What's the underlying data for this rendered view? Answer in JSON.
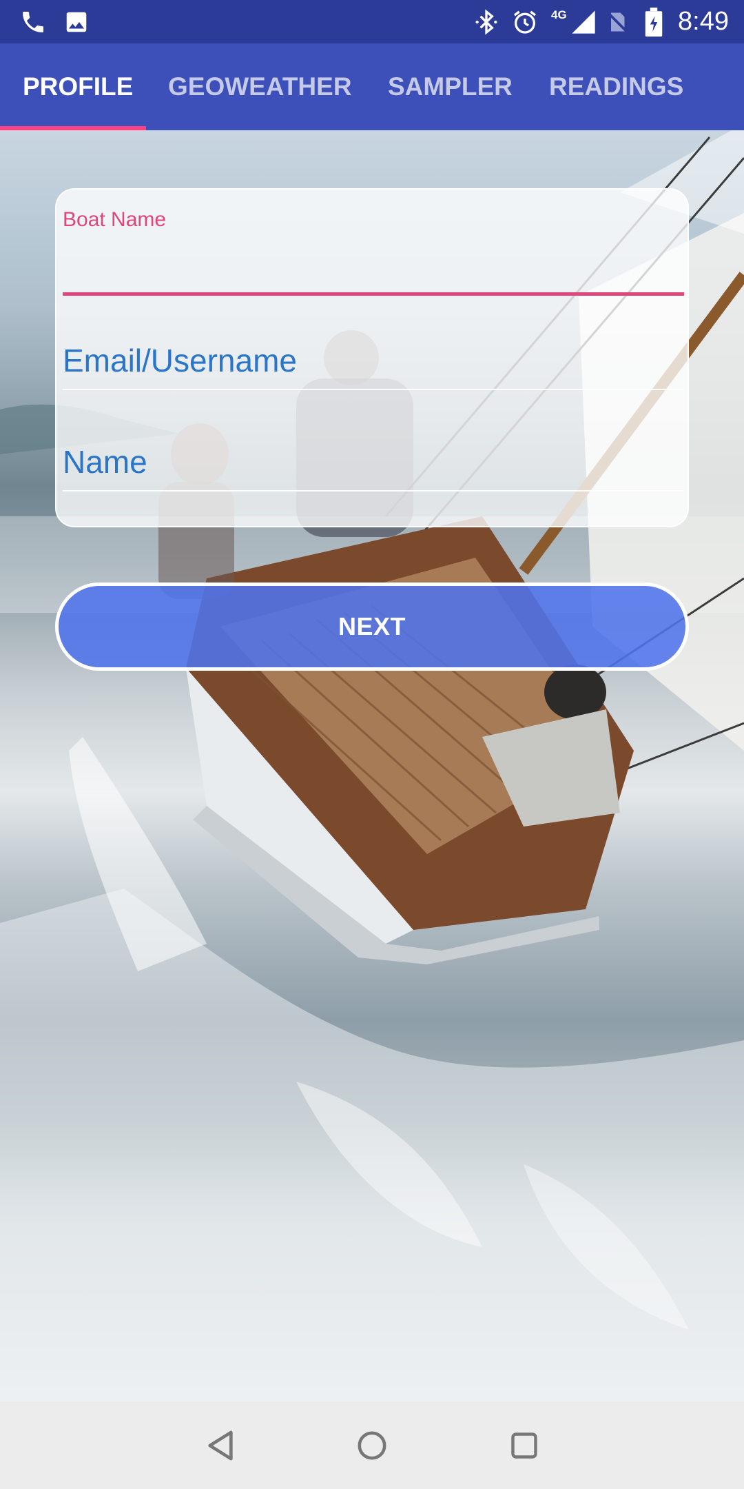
{
  "status_bar": {
    "time": "8:49",
    "network": "4G",
    "icons": [
      "phone-icon",
      "image-icon",
      "bluetooth-icon",
      "alarm-icon",
      "signal-icon",
      "no-sim-icon",
      "battery-icon"
    ]
  },
  "tabs": [
    {
      "label": "PROFILE",
      "active": true
    },
    {
      "label": "GEOWEATHER",
      "active": false
    },
    {
      "label": "SAMPLER",
      "active": false
    },
    {
      "label": "READINGS",
      "active": false
    }
  ],
  "form": {
    "boat_name": {
      "label": "Boat Name",
      "value": ""
    },
    "email": {
      "placeholder": "Email/Username",
      "value": ""
    },
    "name": {
      "placeholder": "Name",
      "value": ""
    }
  },
  "next_button": {
    "label": "NEXT"
  },
  "nav": {
    "icons": [
      "back-icon",
      "home-icon",
      "recents-icon"
    ]
  },
  "colors": {
    "status_bar": "#2c3a98",
    "tab_bar": "#3d4fb8",
    "tab_indicator": "#ff4081",
    "accent_pink": "#e0457b",
    "placeholder_blue": "#2b75c9",
    "button_fill": "#5073eb"
  }
}
